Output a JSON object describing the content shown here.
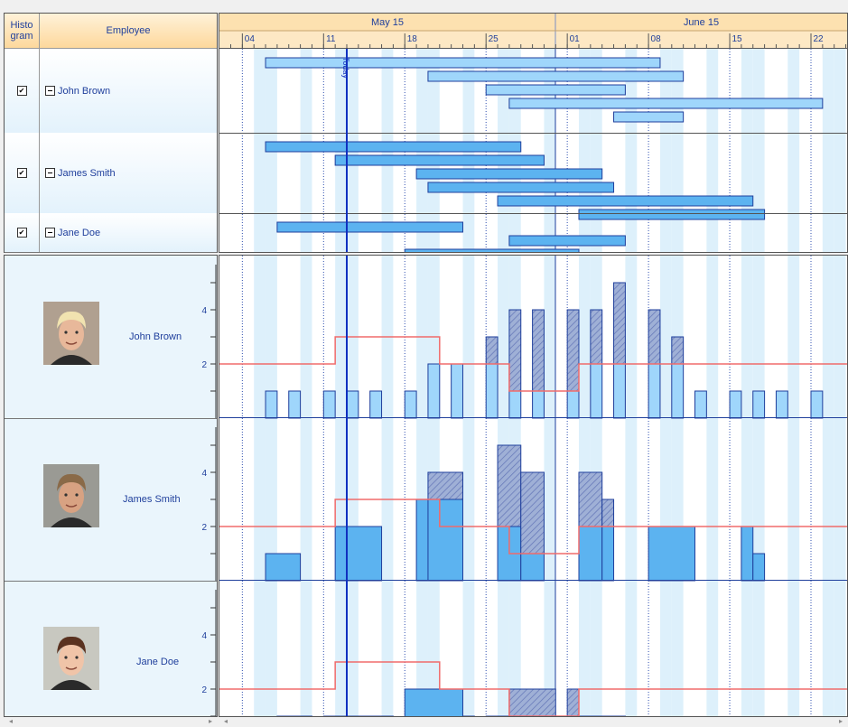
{
  "header": {
    "histogram_label": "Histo\ngram",
    "employee_label": "Employee",
    "months": [
      {
        "label": "May 15",
        "start": 0,
        "end": 31
      },
      {
        "label": "June 15",
        "start": 31,
        "end": 61
      }
    ],
    "ticks": [
      {
        "day": 1,
        "label": "04"
      },
      {
        "day": 8,
        "label": "11"
      },
      {
        "day": 15,
        "label": "18"
      },
      {
        "day": 22,
        "label": "25"
      },
      {
        "day": 29,
        "label": "01"
      },
      {
        "day": 36,
        "label": "08"
      },
      {
        "day": 43,
        "label": "15"
      },
      {
        "day": 50,
        "label": "22"
      }
    ]
  },
  "today": {
    "label": "Today",
    "day": 10.0
  },
  "employees": [
    {
      "name": "John Brown",
      "checked": true,
      "tasks": [
        [
          3,
          37
        ],
        [
          17,
          39
        ],
        [
          22,
          34
        ],
        [
          24,
          51
        ],
        [
          33,
          39
        ]
      ],
      "histogram": {
        "bars": [
          [
            3,
            4,
            1
          ],
          [
            5,
            6,
            1
          ],
          [
            8,
            9,
            1
          ],
          [
            10,
            11,
            1
          ],
          [
            12,
            13,
            1
          ],
          [
            15,
            16,
            1
          ],
          [
            17,
            18,
            2
          ],
          [
            19,
            20,
            2
          ],
          [
            22,
            23,
            3
          ],
          [
            24,
            25,
            4
          ],
          [
            26,
            27,
            4
          ],
          [
            29,
            30,
            4
          ],
          [
            31,
            32,
            4
          ],
          [
            33,
            34,
            5
          ],
          [
            36,
            37,
            4
          ],
          [
            38,
            39,
            3
          ],
          [
            40,
            41,
            1
          ],
          [
            43,
            44,
            1
          ],
          [
            45,
            46,
            1
          ],
          [
            47,
            48,
            1
          ],
          [
            50,
            51,
            1
          ]
        ],
        "capacity": [
          [
            0,
            2
          ],
          [
            9,
            3
          ],
          [
            18,
            2
          ],
          [
            24,
            1
          ],
          [
            30,
            2
          ],
          [
            54,
            2
          ]
        ]
      }
    },
    {
      "name": "James Smith",
      "checked": true,
      "tasks": [
        [
          3,
          25
        ],
        [
          9,
          27
        ],
        [
          16,
          32
        ],
        [
          17,
          33
        ],
        [
          23,
          45
        ],
        [
          30,
          46
        ]
      ],
      "histogram": {
        "bars": [
          [
            3,
            6,
            1
          ],
          [
            9,
            13,
            2
          ],
          [
            16,
            18,
            3
          ],
          [
            17,
            20,
            4
          ],
          [
            23,
            25,
            5
          ],
          [
            25,
            27,
            4
          ],
          [
            30,
            32,
            4
          ],
          [
            32,
            33,
            3
          ],
          [
            36,
            40,
            2
          ],
          [
            44,
            45,
            2
          ],
          [
            45,
            46,
            1
          ]
        ],
        "capacity": [
          [
            0,
            2
          ],
          [
            9,
            3
          ],
          [
            18,
            2
          ],
          [
            24,
            1
          ],
          [
            30,
            2
          ],
          [
            54,
            2
          ]
        ]
      }
    },
    {
      "name": "Jane Doe",
      "checked": true,
      "tasks": [
        [
          4,
          20
        ],
        [
          24,
          34
        ],
        [
          15,
          30
        ]
      ],
      "histogram": {
        "bars": [
          [
            4,
            7,
            1
          ],
          [
            8,
            14,
            1
          ],
          [
            15,
            20,
            2
          ],
          [
            20,
            21,
            1
          ],
          [
            22,
            28,
            1
          ],
          [
            24,
            28,
            2
          ],
          [
            29,
            30,
            2
          ],
          [
            30,
            34,
            1
          ]
        ],
        "capacity": [
          [
            0,
            2
          ],
          [
            9,
            3
          ],
          [
            18,
            2
          ],
          [
            24,
            1
          ],
          [
            30,
            2
          ],
          [
            54,
            2
          ]
        ]
      }
    }
  ],
  "histogram_axis": {
    "labels": [
      "2",
      "4"
    ]
  },
  "colors": {
    "bar": "#9fd6fb",
    "bar_dark": "#5cb3f0",
    "over": "#9fb0d6",
    "capacity": "#f06b6b",
    "weekend": "#ddf0fb",
    "today": "#1030c0",
    "header_bg": "#fde1b0"
  },
  "scroll": {
    "left": "◂",
    "right": "▸"
  }
}
